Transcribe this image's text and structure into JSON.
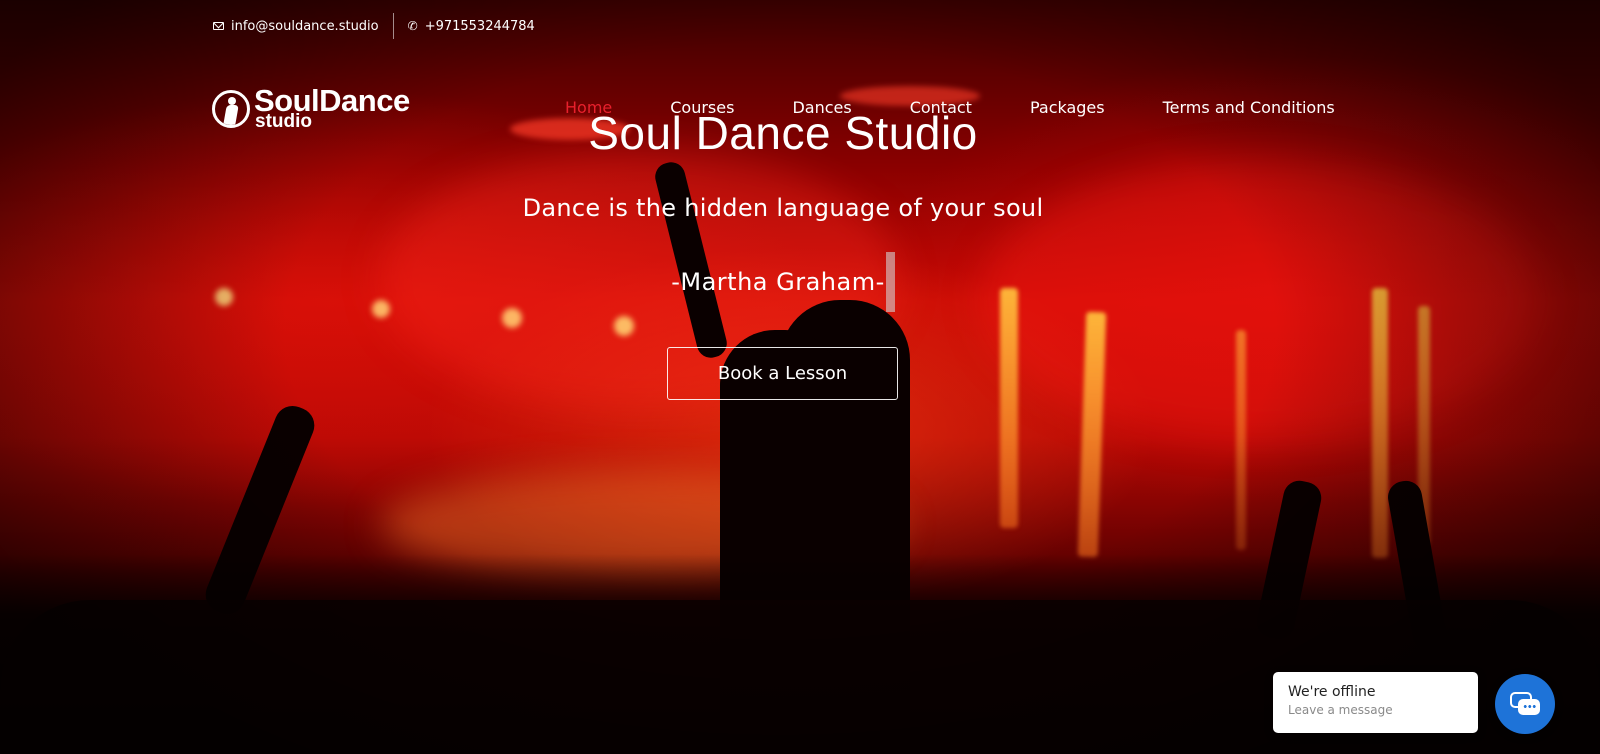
{
  "topbar": {
    "email": "info@souldance.studio",
    "email_icon": "mail-icon",
    "phone": "+971553244784",
    "phone_icon": "phone-icon"
  },
  "logo": {
    "word": "SoulDance",
    "sub": "studio"
  },
  "nav": {
    "items": [
      {
        "label": "Home",
        "active": true
      },
      {
        "label": "Courses",
        "active": false
      },
      {
        "label": "Dances",
        "active": false
      },
      {
        "label": "Contact",
        "active": false
      },
      {
        "label": "Packages",
        "active": false
      },
      {
        "label": "Terms and Conditions",
        "active": false
      }
    ]
  },
  "hero": {
    "title": "Soul Dance Studio",
    "tagline": "Dance is the hidden language of your soul",
    "author": "-Martha Graham-",
    "cta_label": "Book a Lesson"
  },
  "chat": {
    "status": "We're offline",
    "cta": "Leave a message",
    "icon": "chat-icon"
  },
  "colors": {
    "nav_active": "#e8202c",
    "chat_bubble": "#1e73d8",
    "background_red": "#c80a05"
  }
}
